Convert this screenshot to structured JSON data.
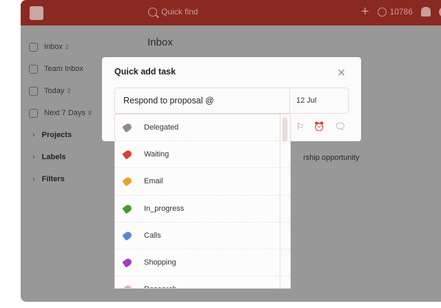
{
  "topbar": {
    "search_placeholder": "Quick find",
    "karma": "10786"
  },
  "sidebar": {
    "items": [
      {
        "label": "Inbox",
        "count": "2"
      },
      {
        "label": "Team Inbox",
        "count": ""
      },
      {
        "label": "Today",
        "count": "3"
      },
      {
        "label": "Next 7 Days",
        "count": "8"
      }
    ],
    "sections": [
      {
        "label": "Projects"
      },
      {
        "label": "Labels"
      },
      {
        "label": "Filters"
      }
    ]
  },
  "main": {
    "title": "Inbox",
    "task_fragment": "rship opportunity"
  },
  "modal": {
    "title": "Quick add task",
    "input_value": "Respond to proposal @",
    "date": "12 Jul"
  },
  "labels": [
    {
      "name": "Delegated",
      "color": "#8c8c8c"
    },
    {
      "name": "Waiting",
      "color": "#db4035"
    },
    {
      "name": "Email",
      "color": "#e8a22d"
    },
    {
      "name": "In_progress",
      "color": "#4a9a2a"
    },
    {
      "name": "Calls",
      "color": "#5a88d4"
    },
    {
      "name": "Shopping",
      "color": "#a43bc2"
    },
    {
      "name": "Research",
      "color": "#e8a8a0"
    }
  ]
}
